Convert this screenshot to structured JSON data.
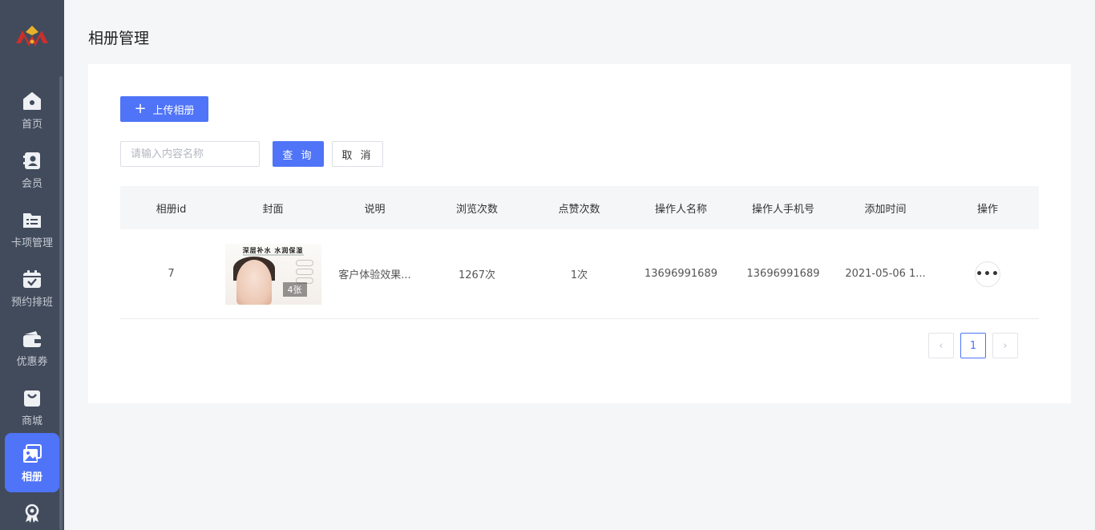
{
  "sidebar": {
    "items": [
      {
        "label": "首页",
        "icon": "home-icon"
      },
      {
        "label": "会员",
        "icon": "member-card-icon"
      },
      {
        "label": "卡项管理",
        "icon": "card-list-icon"
      },
      {
        "label": "预约排班",
        "icon": "calendar-check-icon"
      },
      {
        "label": "优惠券",
        "icon": "coupon-wallet-icon"
      },
      {
        "label": "商城",
        "icon": "shopping-bag-icon"
      },
      {
        "label": "相册",
        "icon": "album-icon",
        "active": true
      },
      {
        "label": "",
        "icon": "award-icon"
      }
    ]
  },
  "page": {
    "title": "相册管理"
  },
  "toolbar": {
    "upload_label": "上传相册"
  },
  "search": {
    "placeholder": "请输入内容名称",
    "query_label": "查 询",
    "cancel_label": "取 消"
  },
  "table": {
    "columns": [
      "相册id",
      "封面",
      "说明",
      "浏览次数",
      "点赞次数",
      "操作人名称",
      "操作人手机号",
      "添加时间",
      "操作"
    ],
    "rows": [
      {
        "id": "7",
        "cover_headline": "深层补水 水润保湿",
        "cover_count": "4张",
        "description": "客户体验效果...",
        "views": "1267次",
        "likes": "1次",
        "operator_name": "13696991689",
        "operator_phone": "13696991689",
        "added_time": "2021-05-06 1...",
        "action": "•••"
      }
    ]
  },
  "pagination": {
    "prev": "‹",
    "current": "1",
    "next": "›"
  },
  "colors": {
    "primary": "#4f74f7",
    "sidebar": "#414b5c"
  }
}
